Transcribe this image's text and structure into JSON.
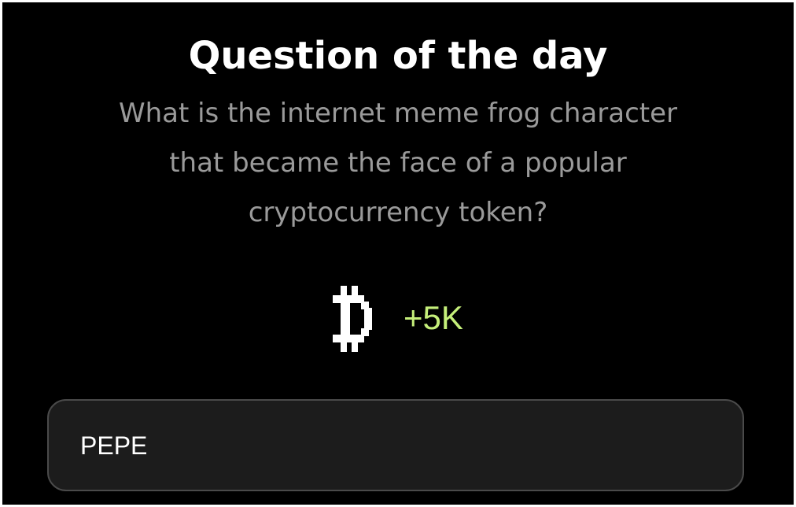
{
  "header": {
    "title": "Question of the day"
  },
  "question": {
    "lines": [
      "What is the internet meme frog character",
      "that became the face of a popular",
      "cryptocurrency token?"
    ]
  },
  "reward": {
    "icon": "pixel-currency-icon",
    "amount": "+5K",
    "color": "#c5ef7a"
  },
  "answer": {
    "value": "PEPE",
    "placeholder": ""
  }
}
